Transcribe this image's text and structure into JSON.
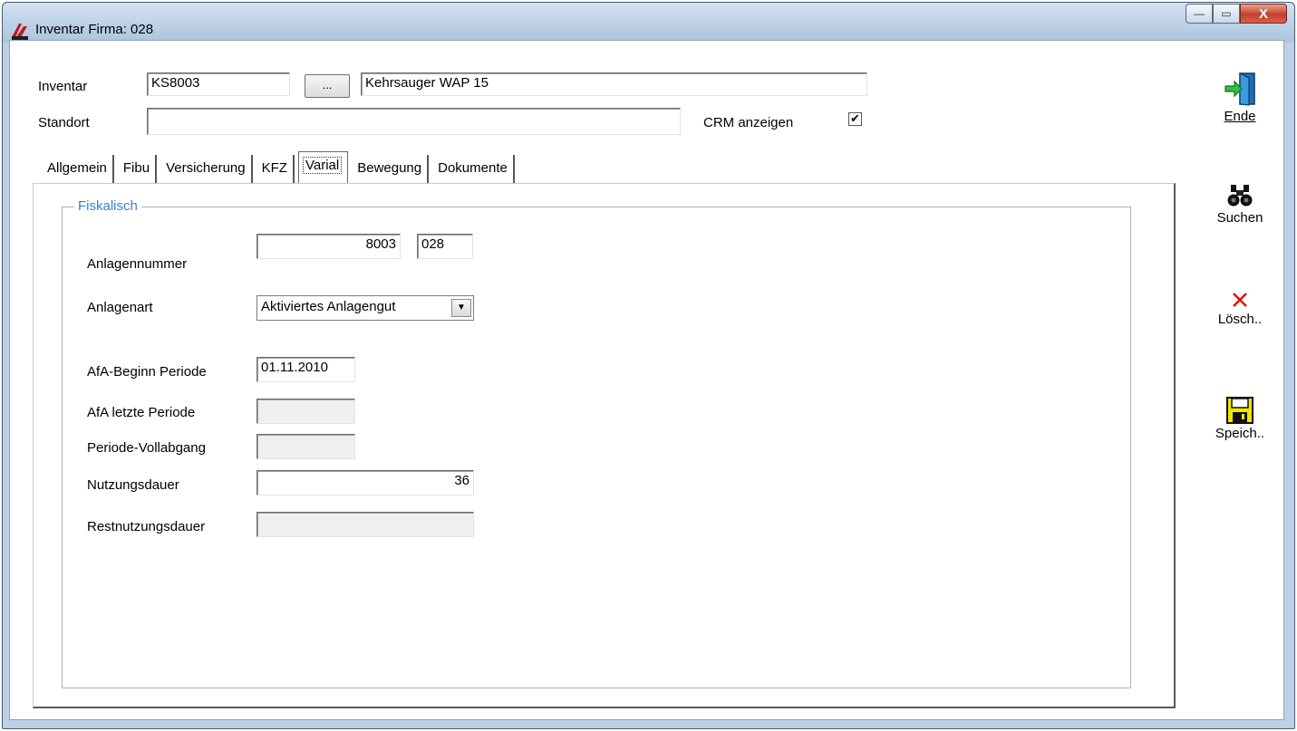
{
  "window": {
    "title": "Inventar Firma: 028",
    "controls": {
      "minimize": "—",
      "maximize": "▭",
      "close": "X"
    }
  },
  "header": {
    "inventar_label": "Inventar",
    "inventar_code": "KS8003",
    "lookup_button": "...",
    "inventar_name": "Kehrsauger WAP 15",
    "standort_label": "Standort",
    "standort_value": "",
    "crm_label": "CRM anzeigen",
    "crm_checked": "✔"
  },
  "tabs": [
    {
      "label": "Allgemein"
    },
    {
      "label": "Fibu"
    },
    {
      "label": "Versicherung"
    },
    {
      "label": "KFZ"
    },
    {
      "label": "Varial"
    },
    {
      "label": "Bewegung"
    },
    {
      "label": "Dokumente"
    }
  ],
  "active_tab": "Varial",
  "fiskalisch": {
    "group_title": "Fiskalisch",
    "anlagennummer_label": "Anlagennummer",
    "anlagennummer_value": "8003",
    "anlagennummer_firma": "028",
    "anlagenart_label": "Anlagenart",
    "anlagenart_value": "Aktiviertes Anlagengut",
    "afa_beginn_label": "AfA-Beginn Periode",
    "afa_beginn_value": "01.11.2010",
    "afa_letzte_label": "AfA letzte Periode",
    "afa_letzte_value": "",
    "vollabgang_label": "Periode-Vollabgang",
    "vollabgang_value": "",
    "nutzungsdauer_label": "Nutzungsdauer",
    "nutzungsdauer_value": "36",
    "restnutzung_label": "Restnutzungsdauer",
    "restnutzung_value": ""
  },
  "toolbar": {
    "ende_label": "Ende",
    "suchen_label": "Suchen",
    "loeschen_label": "Lösch..",
    "speichern_label": "Speich.."
  },
  "colors": {
    "title_bar": "#bcd0e6",
    "group_title": "#3a7fd0",
    "close_button": "#c4412b",
    "delete_icon": "#e01010",
    "save_icon": "#f2e600"
  }
}
